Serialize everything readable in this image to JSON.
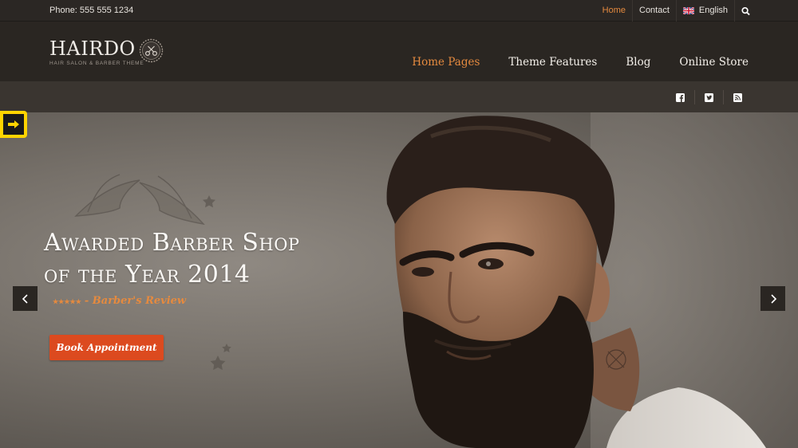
{
  "topbar": {
    "phone": "Phone: 555 555 1234",
    "nav": [
      {
        "label": "Home",
        "active": true
      },
      {
        "label": "Contact",
        "active": false
      },
      {
        "label": "English",
        "active": false
      }
    ],
    "search_icon": "search-icon"
  },
  "header": {
    "logo_name": "HAIRDO",
    "logo_tagline": "HAIR SALON & BARBER THEME",
    "nav": [
      {
        "label": "Home Pages",
        "active": true
      },
      {
        "label": "Theme Features",
        "active": false
      },
      {
        "label": "Blog",
        "active": false
      },
      {
        "label": "Online Store",
        "active": false
      }
    ]
  },
  "social": [
    "facebook-icon",
    "twitter-icon",
    "rss-icon"
  ],
  "hero": {
    "title_line1": "Awarded Barber Shop",
    "title_line2": "of the Year 2014",
    "stars": "★★★★★",
    "rating": 5,
    "review": "- Barber's Review",
    "button": "Book Appointment"
  },
  "colors": {
    "accent": "#e58a3f",
    "button": "#dc4a1f",
    "dark": "#2a2622",
    "widget": "#ffd400"
  }
}
